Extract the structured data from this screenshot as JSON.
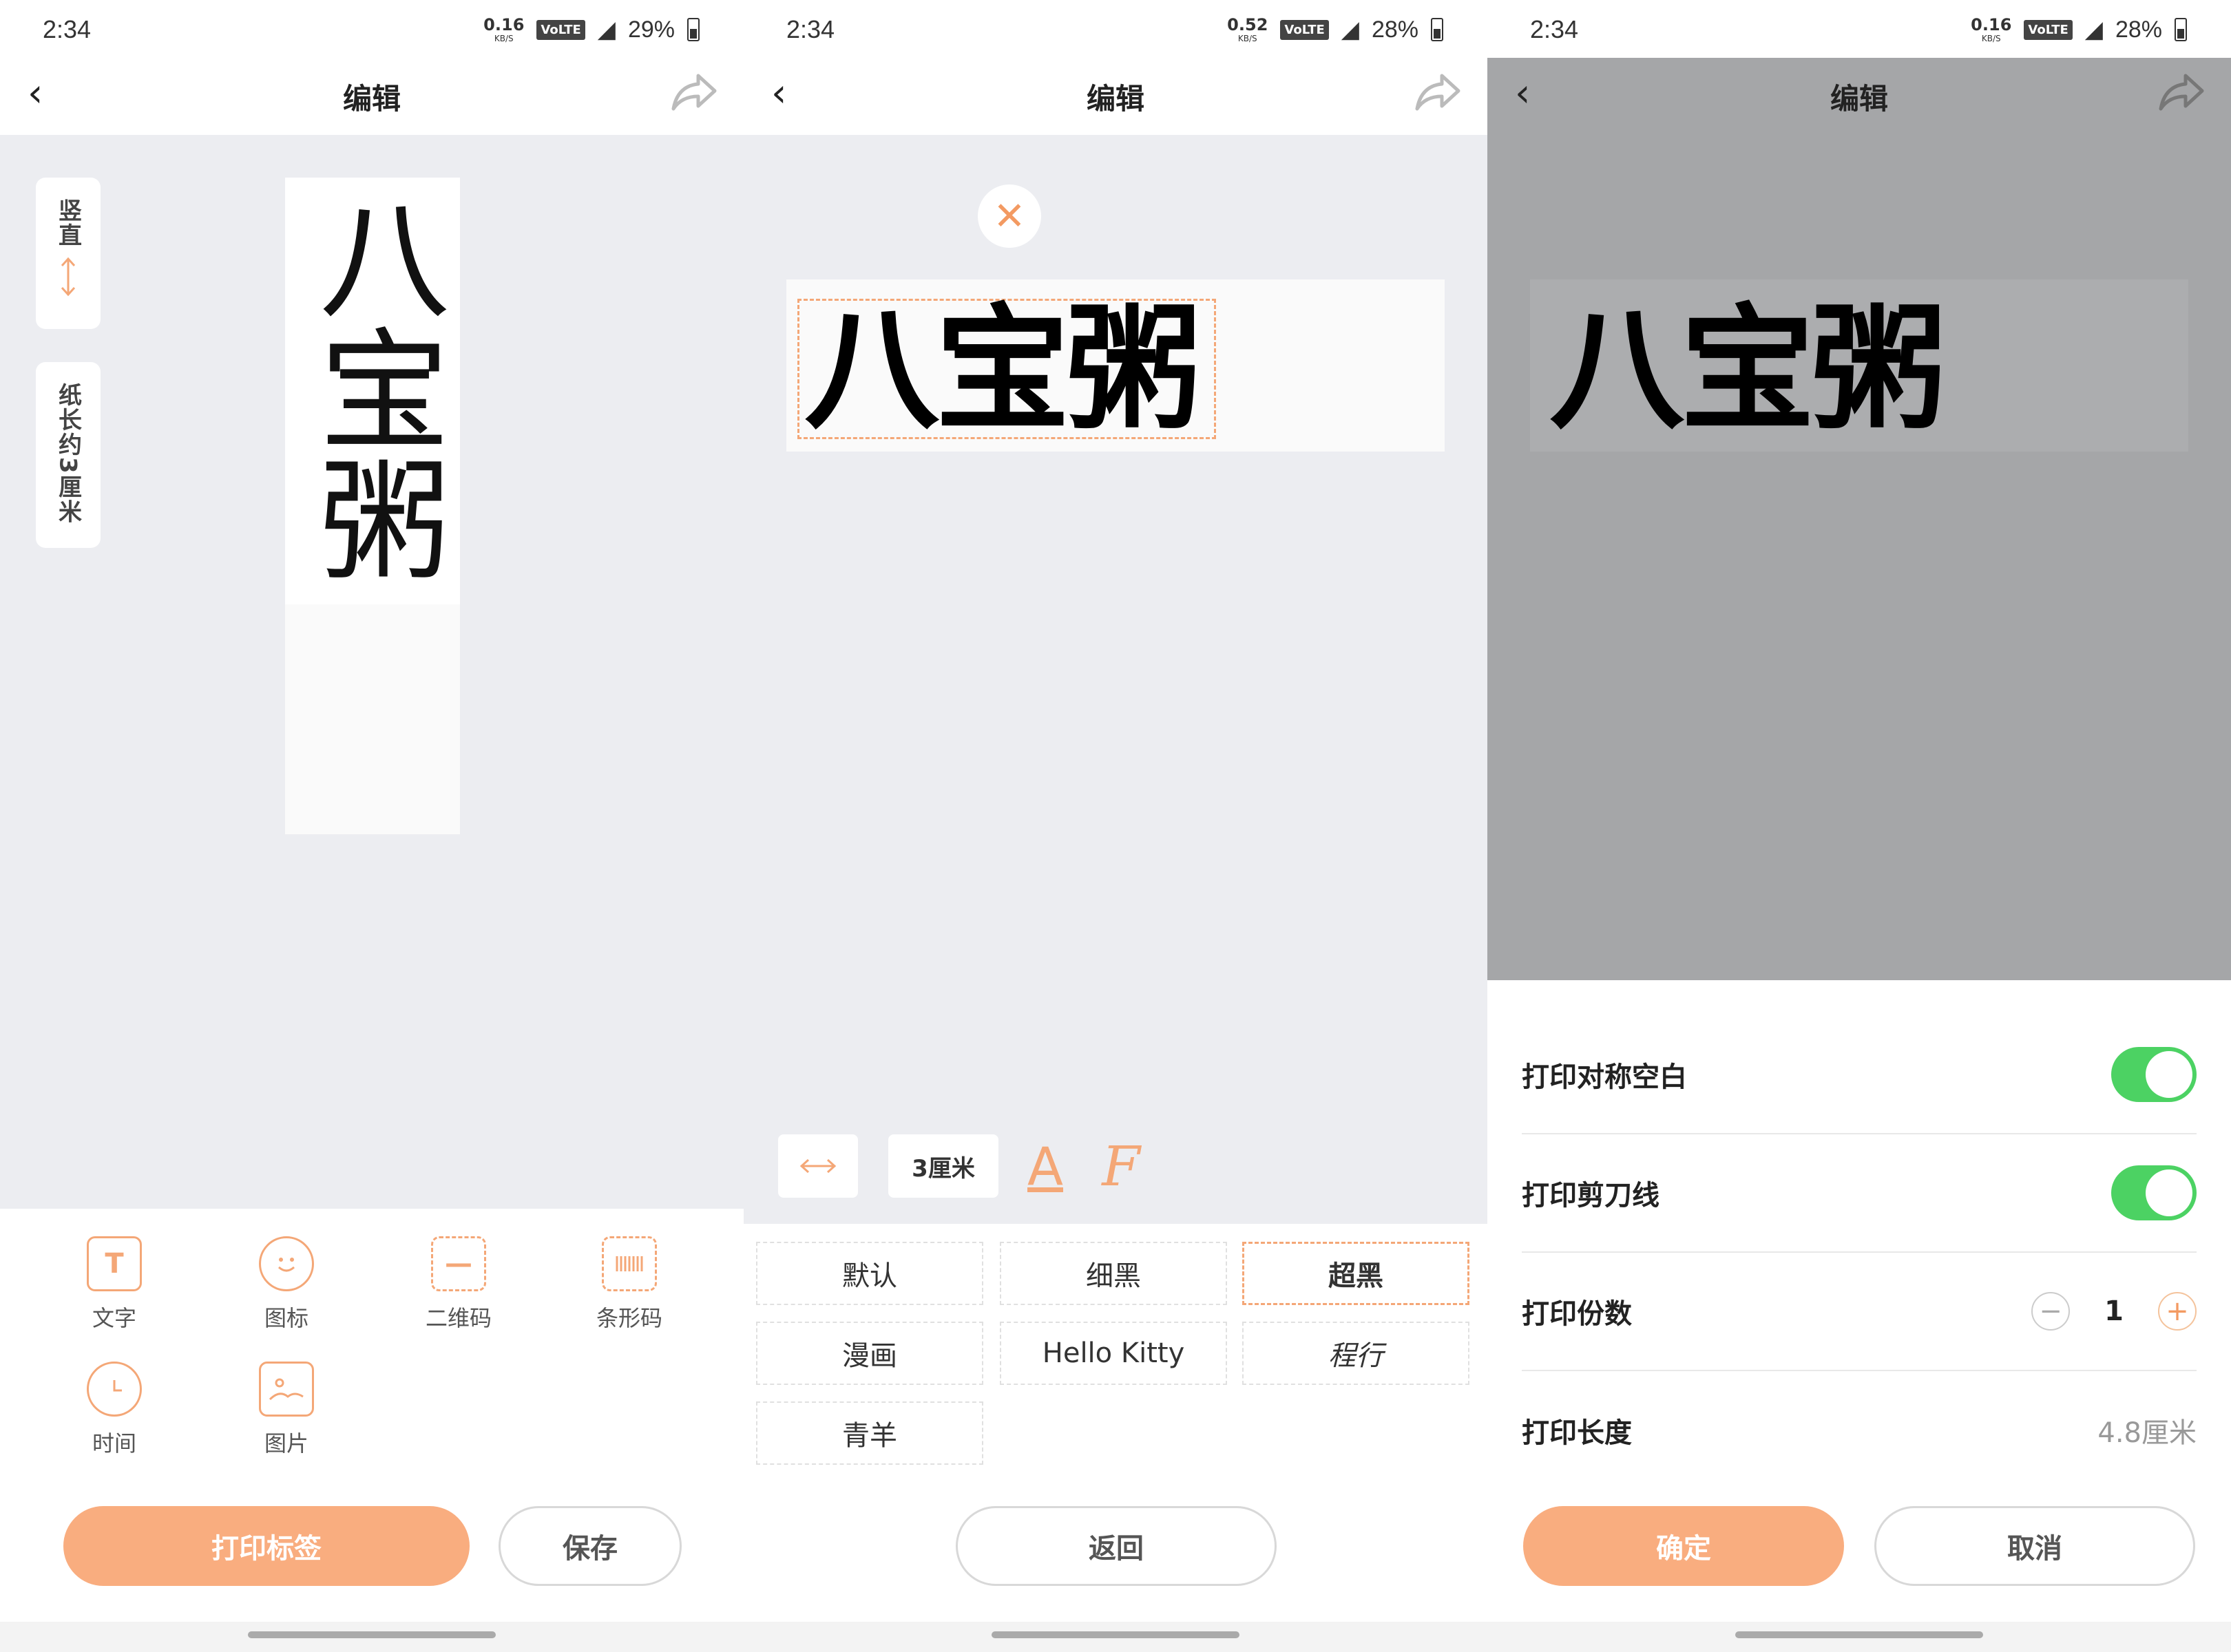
{
  "status_bars": [
    {
      "time": "2:34",
      "speed": "0.16",
      "speed_unit": "KB/S",
      "volte": "VoLTE",
      "battery": "29%"
    },
    {
      "time": "2:34",
      "speed": "0.52",
      "speed_unit": "KB/S",
      "volte": "VoLTE",
      "battery": "28%"
    },
    {
      "time": "2:34",
      "speed": "0.16",
      "speed_unit": "KB/S",
      "volte": "VoLTE",
      "battery": "28%"
    }
  ],
  "header": {
    "title": "编辑",
    "back_icon": "chevron-left-icon",
    "share_icon": "share-icon"
  },
  "editor": {
    "orientation_label": "竖直",
    "paper_label": "纸长约3厘米",
    "label_text": "八宝粥",
    "tools": [
      {
        "label": "文字",
        "icon": "text-icon"
      },
      {
        "label": "图标",
        "icon": "smiley-icon"
      },
      {
        "label": "二维码",
        "icon": "qrcode-icon"
      },
      {
        "label": "条形码",
        "icon": "barcode-icon"
      },
      {
        "label": "时间",
        "icon": "clock-icon"
      },
      {
        "label": "图片",
        "icon": "image-icon"
      }
    ],
    "print_button": "打印标签",
    "save_button": "保存"
  },
  "font_picker": {
    "label_text": "八宝粥",
    "size_label": "3厘米",
    "color_glyph": "A",
    "font_glyph": "F",
    "fonts": [
      "默认",
      "细黑",
      "超黑",
      "漫画",
      "Hello Kitty",
      "程行",
      "青羊"
    ],
    "selected_font": "超黑",
    "back_button": "返回"
  },
  "print_settings": {
    "label_text": "八宝粥",
    "symmetric_blank": "打印对称空白",
    "cut_line": "打印剪刀线",
    "copies_label": "打印份数",
    "copies": "1",
    "minus": "−",
    "plus": "+",
    "length_label": "打印长度",
    "length": "4.8厘米",
    "confirm_button": "确定",
    "cancel_button": "取消"
  },
  "colors": {
    "accent": "#f9ad7f",
    "toggle_on": "#4cd263",
    "canvas": "#ecedf1",
    "overlay": "#a5a6a8"
  }
}
